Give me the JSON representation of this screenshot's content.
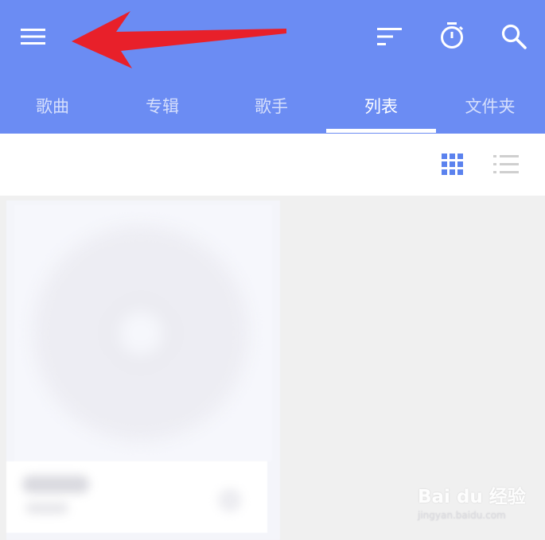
{
  "tabs": [
    {
      "label": "歌曲"
    },
    {
      "label": "专辑"
    },
    {
      "label": "歌手"
    },
    {
      "label": "列表"
    },
    {
      "label": "文件夹"
    }
  ],
  "active_tab": "列表",
  "view_mode": "grid",
  "colors": {
    "appbar": "#6b8cf3",
    "accent_icon": "#5b82ee",
    "annotation_arrow": "#e8202a"
  },
  "icons": {
    "menu": "menu-icon",
    "sort": "sort-icon",
    "timer": "timer-icon",
    "search": "search-icon",
    "grid_view": "grid-view-icon",
    "list_view": "list-view-icon"
  },
  "watermark": {
    "logo": "Bai du 经验",
    "url": "jingyan.baidu.com"
  }
}
